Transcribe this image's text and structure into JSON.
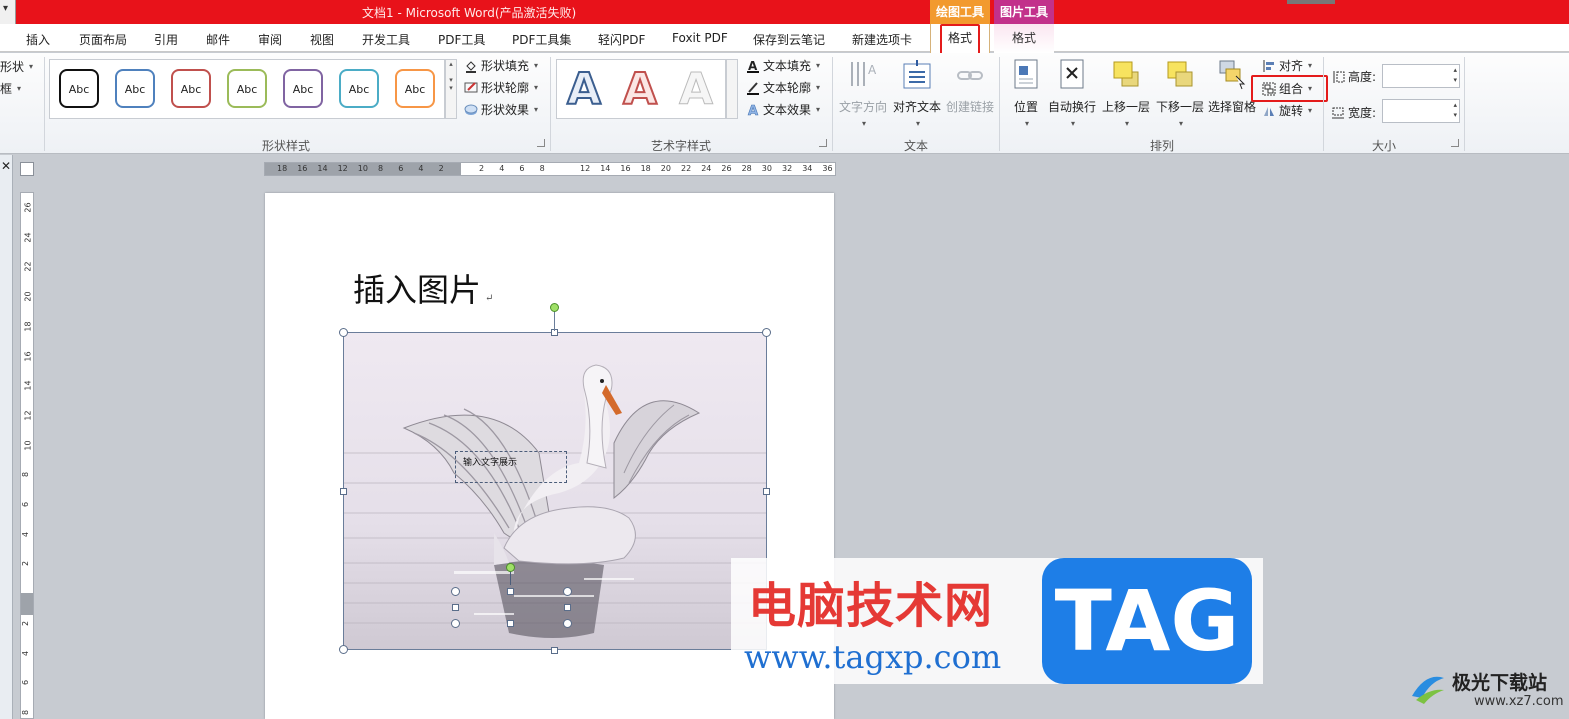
{
  "titlebar": {
    "title": "文档1  -  Microsoft Word(产品激活失败)",
    "context_drawing": "绘图工具",
    "context_picture": "图片工具"
  },
  "tabs": [
    "插入",
    "页面布局",
    "引用",
    "邮件",
    "审阅",
    "视图",
    "开发工具",
    "PDF工具",
    "PDF工具集",
    "轻闪PDF",
    "Foxit PDF",
    "保存到云笔记",
    "新建选项卡"
  ],
  "context_tabs": {
    "drawing_format": "格式",
    "picture_format": "格式"
  },
  "ribbon": {
    "left_partial": {
      "shape": "形状",
      "frame": "框"
    },
    "shape_styles": {
      "label": "形状样式",
      "thumb_text": "Abc",
      "thumbs": [
        {
          "border": "#111111"
        },
        {
          "border": "#4f81bd"
        },
        {
          "border": "#c0504d"
        },
        {
          "border": "#9bbb59"
        },
        {
          "border": "#8064a2"
        },
        {
          "border": "#4bacc6"
        },
        {
          "border": "#f79646"
        }
      ],
      "fill": "形状填充",
      "outline": "形状轮廓",
      "effects": "形状效果"
    },
    "wordart": {
      "label": "艺术字样式",
      "letter": "A",
      "text_fill": "文本填充",
      "text_outline": "文本轮廓",
      "text_effects": "文本效果"
    },
    "text": {
      "label": "文本",
      "direction": "文字方向",
      "align": "对齐文本",
      "link": "创建链接"
    },
    "arrange": {
      "label": "排列",
      "position": "位置",
      "wrap": "自动换行",
      "bring_forward": "上移一层",
      "send_backward": "下移一层",
      "selection_pane": "选择窗格",
      "align": "对齐",
      "group": "组合",
      "rotate": "旋转"
    },
    "size": {
      "label": "大小",
      "height": "高度:",
      "width": "宽度:"
    }
  },
  "ruler": {
    "h": [
      "18",
      "16",
      "14",
      "12",
      "10",
      "8",
      "6",
      "4",
      "2",
      "",
      "2",
      "4",
      "6",
      "8",
      "",
      "12",
      "14",
      "16",
      "18",
      "20",
      "22",
      "24",
      "26",
      "28",
      "30",
      "32",
      "34",
      "36"
    ],
    "v": [
      "26",
      "24",
      "22",
      "20",
      "18",
      "16",
      "14",
      "12",
      "10",
      "8",
      "6",
      "4",
      "2",
      "",
      "2",
      "4",
      "6",
      "8"
    ]
  },
  "document": {
    "heading": "插入图片",
    "textbox": "输入文字展示"
  },
  "watermark": {
    "cn": "电脑技术网",
    "url": "www.tagxp.com",
    "tag": "TAG",
    "site2_cn": "极光下载站",
    "site2_url": "www.xz7.com"
  }
}
